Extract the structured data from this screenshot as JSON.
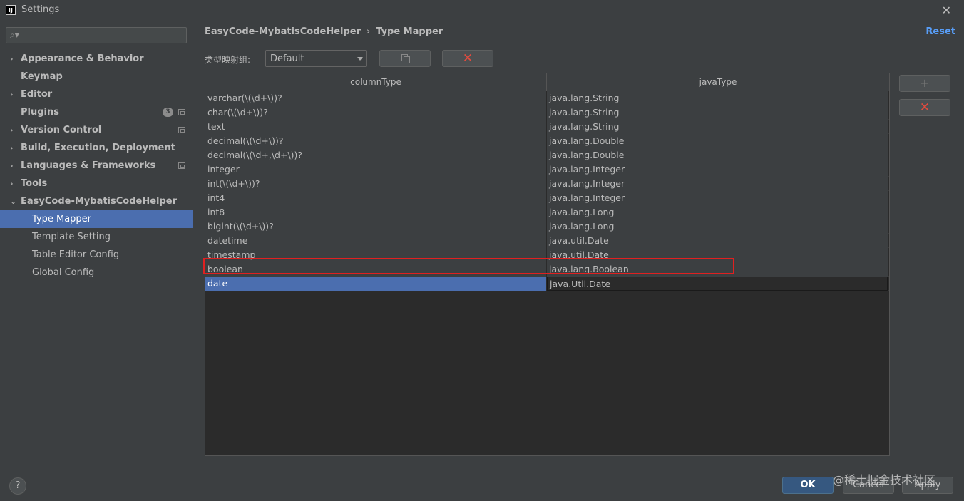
{
  "window": {
    "title": "Settings",
    "logo_text": "IJ"
  },
  "sidebar": {
    "search_placeholder": "",
    "items": [
      {
        "label": "Appearance & Behavior"
      },
      {
        "label": "Keymap"
      },
      {
        "label": "Editor"
      },
      {
        "label": "Plugins",
        "badge": "3"
      },
      {
        "label": "Version Control"
      },
      {
        "label": "Build, Execution, Deployment"
      },
      {
        "label": "Languages & Frameworks"
      },
      {
        "label": "Tools"
      },
      {
        "label": "EasyCode-MybatisCodeHelper"
      },
      {
        "label": "Type Mapper"
      },
      {
        "label": "Template Setting"
      },
      {
        "label": "Table Editor Config"
      },
      {
        "label": "Global Config"
      }
    ]
  },
  "header": {
    "breadcrumb_parent": "EasyCode-MybatisCodeHelper",
    "breadcrumb_sep": "›",
    "breadcrumb_current": "Type Mapper",
    "reset_label": "Reset"
  },
  "toolbar": {
    "group_label": "类型映射组:",
    "group_value": "Default"
  },
  "table": {
    "headers": [
      "columnType",
      "javaType"
    ],
    "rows": [
      [
        "varchar(\\(\\d+\\))?",
        "java.lang.String"
      ],
      [
        "char(\\(\\d+\\))?",
        "java.lang.String"
      ],
      [
        "text",
        "java.lang.String"
      ],
      [
        "decimal(\\(\\d+\\))?",
        "java.lang.Double"
      ],
      [
        "decimal(\\(\\d+,\\d+\\))?",
        "java.lang.Double"
      ],
      [
        "integer",
        "java.lang.Integer"
      ],
      [
        "int(\\(\\d+\\))?",
        "java.lang.Integer"
      ],
      [
        "int4",
        "java.lang.Integer"
      ],
      [
        "int8",
        "java.lang.Long"
      ],
      [
        "bigint(\\(\\d+\\))?",
        "java.lang.Long"
      ],
      [
        "datetime",
        "java.util.Date"
      ],
      [
        "timestamp",
        "java.util.Date"
      ],
      [
        "boolean",
        "java.lang.Boolean"
      ],
      [
        "date",
        "java.Util.Date"
      ]
    ],
    "selected_row": 13
  },
  "footer": {
    "help_label": "?",
    "ok_label": "OK",
    "cancel_label": "Cancel",
    "apply_label": "Apply",
    "watermark": "@稀土掘金技术社区"
  },
  "colors": {
    "accent": "#4b6eaf",
    "link": "#589df6",
    "danger": "#e34b3e",
    "highlight": "#e02020"
  }
}
